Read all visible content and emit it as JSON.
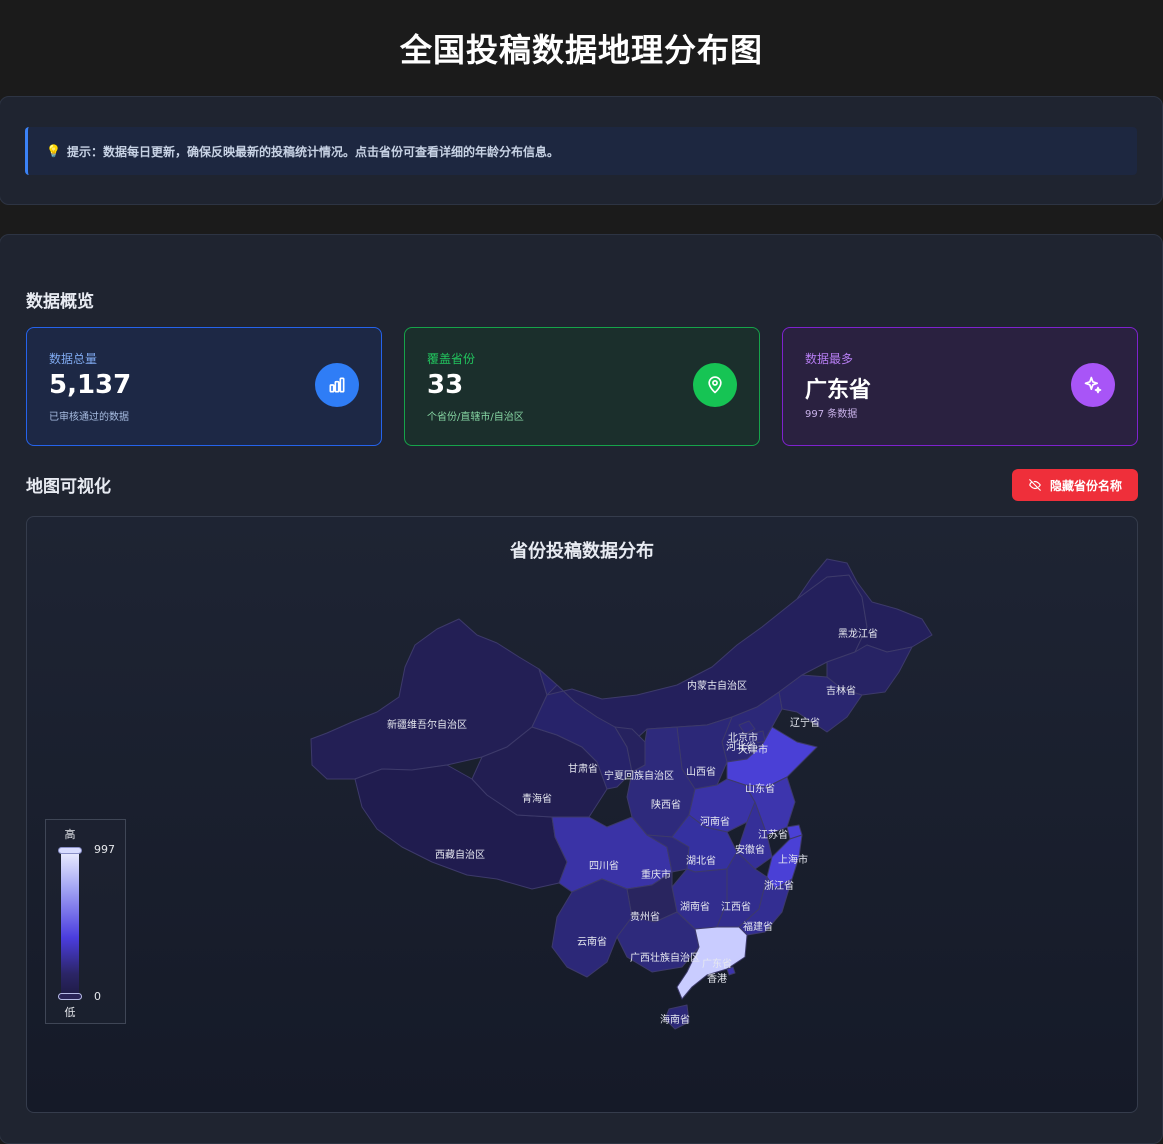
{
  "header": {
    "title": "全国投稿数据地理分布图"
  },
  "tip": {
    "icon": "lightbulb-icon",
    "text": "提示：数据每日更新，确保反映最新的投稿统计情况。点击省份可查看详细的年龄分布信息。"
  },
  "overview": {
    "title": "数据概览",
    "cards": [
      {
        "label": "数据总量",
        "value": "5,137",
        "sub": "已审核通过的数据",
        "icon": "bar-chart-icon"
      },
      {
        "label": "覆盖省份",
        "value": "33",
        "sub": "个省份/直辖市/自治区",
        "icon": "map-pin-icon"
      },
      {
        "label": "数据最多",
        "value": "广东省",
        "sub": "997 条数据",
        "icon": "sparkles-icon"
      }
    ]
  },
  "map_section": {
    "title": "地图可视化",
    "toggle_label": "隐藏省份名称",
    "toggle_icon": "eye-off-icon",
    "map_title": "省份投稿数据分布",
    "legend": {
      "high": "高",
      "low": "低",
      "max": "997",
      "min": "0"
    },
    "color_scale": [
      "#1e1b45",
      "#2b2566",
      "#4b3dde",
      "#a6a8f5",
      "#eef0ff"
    ],
    "provinces": {
      "xinjiang": "新疆维吾尔自治区",
      "xizang": "西藏自治区",
      "qinghai": "青海省",
      "gansu": "甘肃省",
      "neimenggu": "内蒙古自治区",
      "heilongjiang": "黑龙江省",
      "jilin": "吉林省",
      "liaoning": "辽宁省",
      "beijing": "北京市",
      "tianjin": "天津市",
      "hebei": "河北省",
      "shanxi": "山西省",
      "ningxia": "宁夏回族自治区",
      "shaanxi": "陕西省",
      "shandong": "山东省",
      "henan": "河南省",
      "jiangsu": "江苏省",
      "anhui": "安徽省",
      "shanghai": "上海市",
      "sichuan": "四川省",
      "chongqing": "重庆市",
      "hubei": "湖北省",
      "zhejiang": "浙江省",
      "hunan": "湖南省",
      "jiangxi": "江西省",
      "guizhou": "贵州省",
      "fujian": "福建省",
      "yunnan": "云南省",
      "guangxi": "广西壮族自治区",
      "guangdong": "广东省",
      "xianggang": "香港",
      "hainan": "海南省"
    }
  }
}
